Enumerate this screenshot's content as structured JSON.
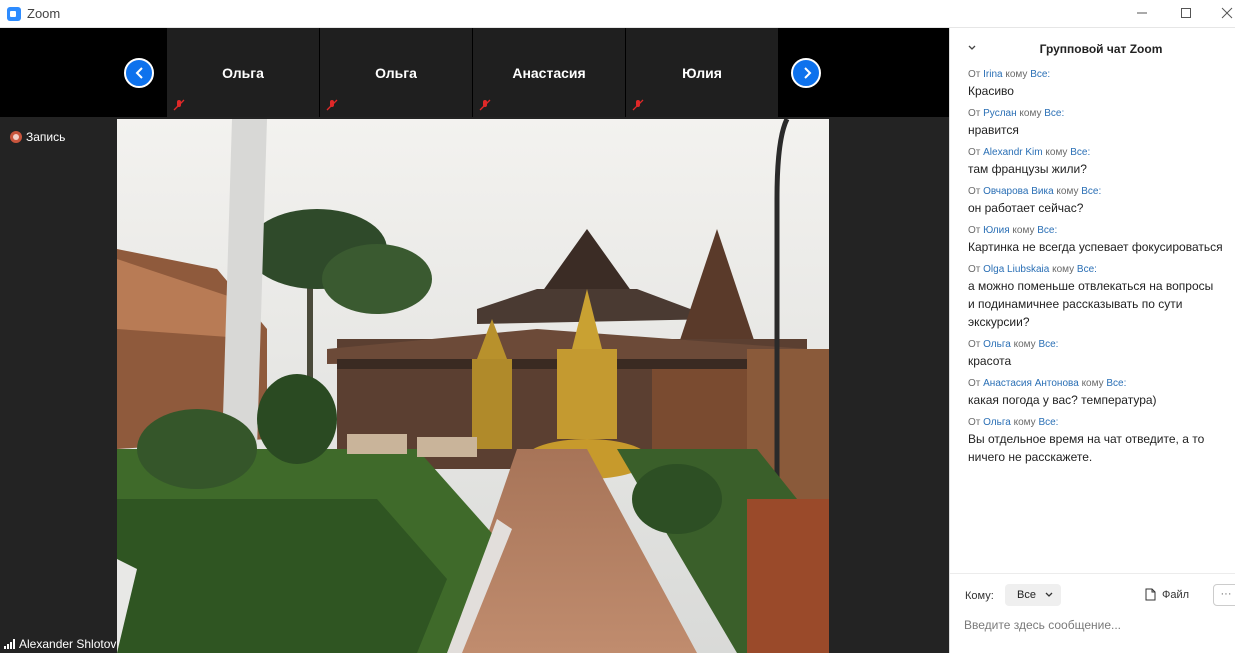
{
  "window": {
    "title": "Zoom"
  },
  "participants": [
    {
      "name": "Ольга"
    },
    {
      "name": "Ольга"
    },
    {
      "name": "Анастасия"
    },
    {
      "name": "Юлия"
    }
  ],
  "recording": {
    "label": "Запись"
  },
  "active_speaker": {
    "name": "Alexander Shlotov"
  },
  "chat": {
    "title": "Групповой чат Zoom",
    "from_word": "От",
    "to_word": "кому",
    "messages": [
      {
        "sender": "Irina",
        "recipient": "Все:",
        "text": "Красиво"
      },
      {
        "sender": "Руслан",
        "recipient": "Все:",
        "text": "нравится"
      },
      {
        "sender": "Alexandr Kim",
        "recipient": "Все:",
        "text": "там французы жили?"
      },
      {
        "sender": "Овчарова Вика",
        "recipient": "Все:",
        "text": "он работает сейчас?"
      },
      {
        "sender": "Юлия",
        "recipient": "Все:",
        "text": "Картинка не всегда успевает фокусироваться"
      },
      {
        "sender": "Olga Liubskaia",
        "recipient": "Все:",
        "text": "а можно поменьше отвлекаться на вопросы и подинамичнее рассказывать по сути экскурсии?"
      },
      {
        "sender": "Ольга",
        "recipient": "Все:",
        "text": "красота"
      },
      {
        "sender": "Анастасия Антонова",
        "recipient": "Все:",
        "text": "какая погода у вас? температура)"
      },
      {
        "sender": "Ольга",
        "recipient": "Все:",
        "text": "Вы отдельное время на чат отведите, а то ничего не расскажете."
      }
    ],
    "to_label": "Кому:",
    "to_value": "Все",
    "file_label": "Файл",
    "more_label": "···",
    "input_placeholder": "Введите здесь сообщение..."
  },
  "colors": {
    "accent": "#0e72ed",
    "link": "#2a6fb5",
    "muted_mic": "#e02828"
  }
}
